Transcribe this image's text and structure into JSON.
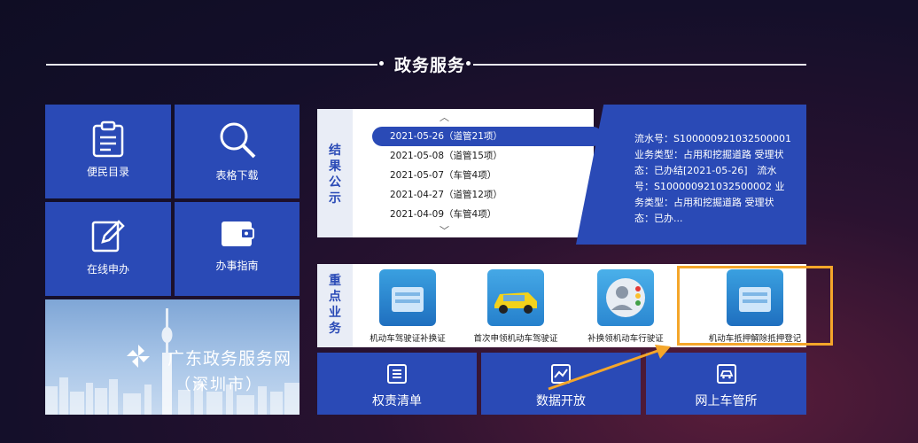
{
  "header": {
    "title": "政务服务"
  },
  "tiles": [
    {
      "label": "便民目录",
      "icon": "clipboard-icon"
    },
    {
      "label": "表格下载",
      "icon": "search-icon"
    },
    {
      "label": "在线申办",
      "icon": "edit-icon"
    },
    {
      "label": "办事指南",
      "icon": "wallet-icon"
    }
  ],
  "banner": {
    "title": "广东政务服务网",
    "subtitle": "（深圳市）"
  },
  "results": {
    "label": "结果公示",
    "items": [
      "2021-05-26（道管21项）",
      "2021-05-08（道管15项）",
      "2021-05-07（车管4项）",
      "2021-04-27（道管12项）",
      "2021-04-09（车管4项）"
    ],
    "detail": "流水号：S100000921032500001 业务类型：占用和挖掘道路 受理状态：已办结[2021-05-26]　流水号：S100000921032500002 业务类型：占用和挖掘道路 受理状态：已办..."
  },
  "key_services": {
    "label": "重点业务",
    "items": [
      {
        "label": "机动车驾驶证补换证",
        "icon": "folder-icon"
      },
      {
        "label": "首次申领机动车驾驶证",
        "icon": "car-icon"
      },
      {
        "label": "补换领机动车行驶证",
        "icon": "person-icon"
      },
      {
        "label": "机动车抵押解除抵押登记",
        "icon": "folder-icon"
      }
    ]
  },
  "bottom": [
    {
      "label": "权责清单",
      "icon": "list-icon"
    },
    {
      "label": "数据开放",
      "icon": "chart-icon"
    },
    {
      "label": "网上车管所",
      "icon": "car-icon"
    }
  ],
  "colors": {
    "accent": "#2a4ab6",
    "highlight": "#f4a62a"
  }
}
